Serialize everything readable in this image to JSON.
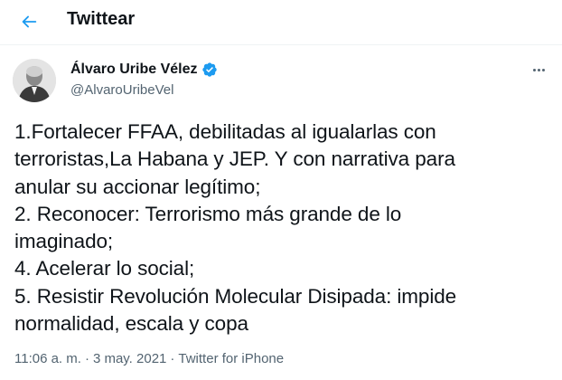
{
  "header": {
    "back_icon": "arrow-left-icon",
    "title": "Twittear"
  },
  "tweet": {
    "author": {
      "name": "Álvaro Uribe Vélez",
      "handle": "@AlvaroUribeVel",
      "verified": true,
      "verified_color": "#1d9bf0"
    },
    "more_icon": "more-horizontal-icon",
    "lines": [
      "1.Fortalecer FFAA, debilitadas al igualarlas con",
      "terroristas,La Habana y JEP. Y con narrativa para",
      "anular su accionar legítimo;",
      "2. Reconocer: Terrorismo más grande de lo",
      "imaginado;",
      "4. Acelerar lo social;",
      "5. Resistir Revolución Molecular Disipada: impide",
      "normalidad, escala y copa"
    ],
    "time": "11:06 a. m.",
    "separator": "·",
    "date": "3 may. 2021",
    "source": "Twitter for iPhone"
  },
  "colors": {
    "accent": "#1d9bf0",
    "text_primary": "#0f1419",
    "text_secondary": "#536471"
  }
}
